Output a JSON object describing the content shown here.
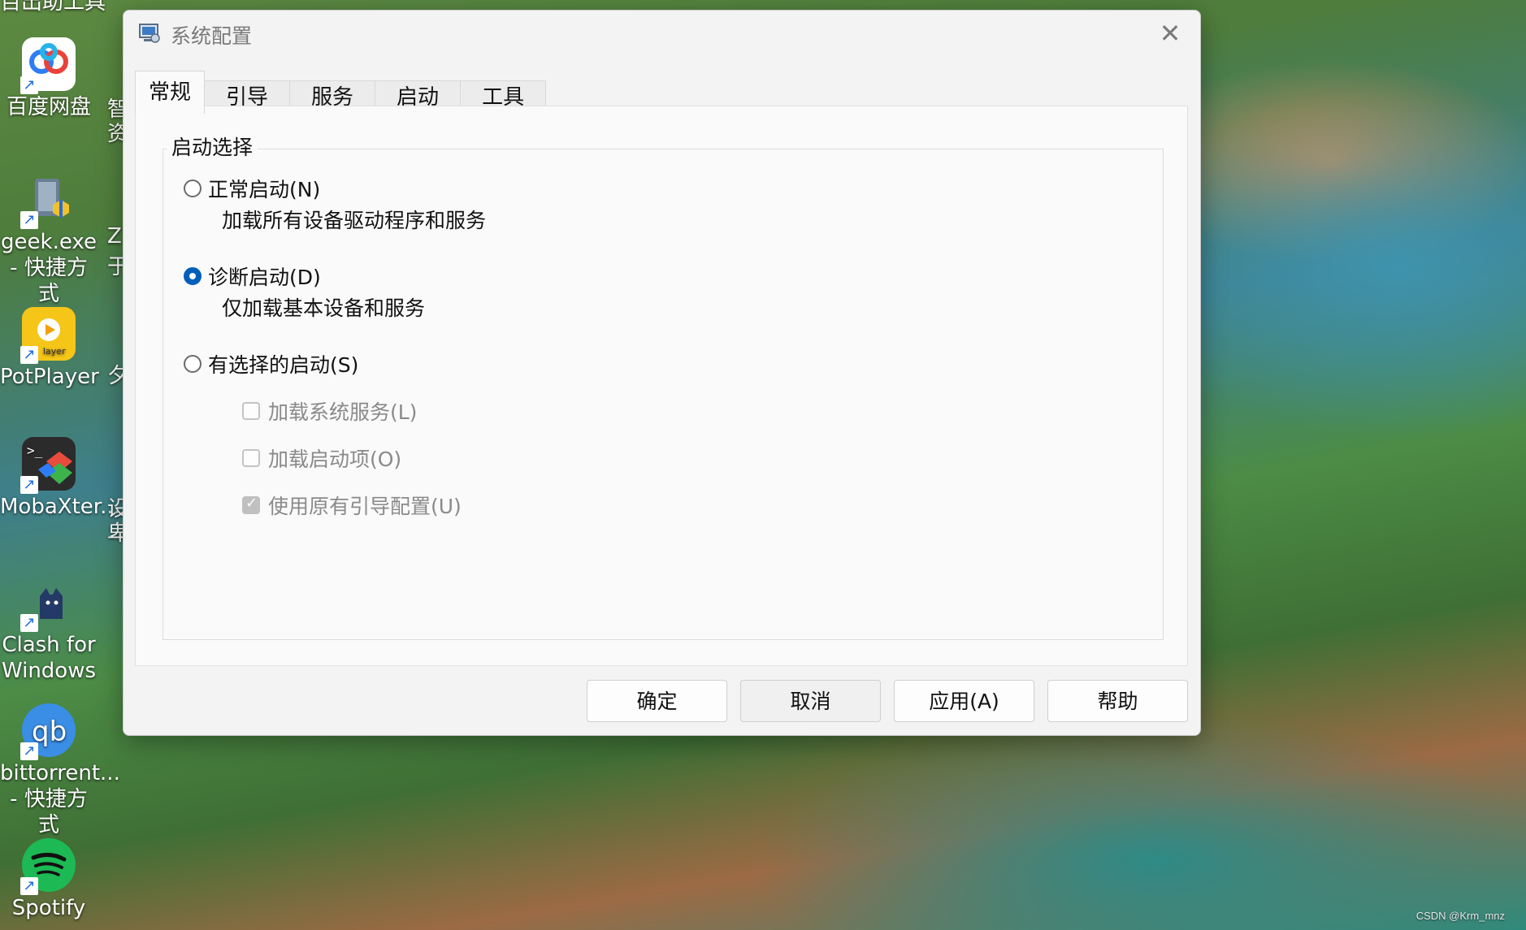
{
  "desktop": {
    "top_partial_label": "百出助工具",
    "icons": [
      {
        "label": "百度网盘",
        "color": "#2f7df6"
      },
      {
        "label": "geek.exe - 快捷方式",
        "color": "#6a7f95"
      },
      {
        "label": "PotPlayer",
        "color": "#f5c518"
      },
      {
        "label": "MobaXter...",
        "color": "#3b3b3b"
      },
      {
        "label": "Clash for Windows",
        "color": "#2a3a5c"
      },
      {
        "label": "bittorrent... - 快捷方式",
        "color": "#3a8ee6"
      },
      {
        "label": "Spotify",
        "color": "#1db954"
      }
    ],
    "partial_second_column": [
      "智",
      "资",
      "Z",
      "于",
      "夕",
      "设",
      "卑"
    ]
  },
  "dialog": {
    "title": "系统配置",
    "close_symbol": "✕",
    "tabs": [
      {
        "label": "常规",
        "active": true
      },
      {
        "label": "引导",
        "active": false
      },
      {
        "label": "服务",
        "active": false
      },
      {
        "label": "启动",
        "active": false
      },
      {
        "label": "工具",
        "active": false
      }
    ],
    "group_title": "启动选择",
    "options": [
      {
        "label": "正常启动(N)",
        "desc": "加载所有设备驱动程序和服务",
        "checked": false
      },
      {
        "label": "诊断启动(D)",
        "desc": "仅加载基本设备和服务",
        "checked": true
      },
      {
        "label": "有选择的启动(S)",
        "checked": false
      }
    ],
    "sub_options": [
      {
        "label": "加载系统服务(L)",
        "checked": false
      },
      {
        "label": "加载启动项(O)",
        "checked": false
      },
      {
        "label": "使用原有引导配置(U)",
        "checked": true
      }
    ],
    "buttons": {
      "ok": "确定",
      "cancel": "取消",
      "apply": "应用(A)",
      "help": "帮助"
    }
  },
  "watermark": "CSDN @Krm_mnz",
  "colors": {
    "accent": "#005fb8"
  }
}
